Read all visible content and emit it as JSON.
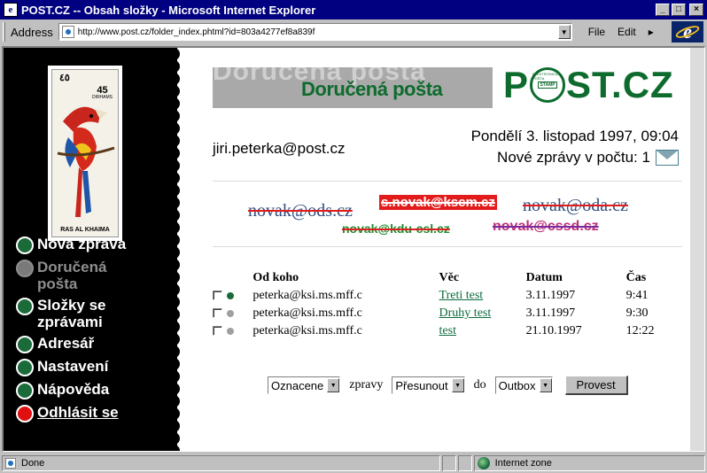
{
  "window": {
    "title": "POST.CZ -- Obsah složky - Microsoft Internet Explorer",
    "controls": {
      "minimize": "_",
      "maximize": "□",
      "close": "×"
    }
  },
  "address_bar": {
    "label": "Address",
    "url": "http://www.post.cz/folder_index.phtml?id=803a4277ef8a839f",
    "menu": [
      "File",
      "Edit"
    ]
  },
  "sidebar": {
    "stamp": {
      "denomination": "٤٥",
      "denomination_value": "45",
      "denomination_unit": "DIRHAMS",
      "country": "RAS AL KHAIMA"
    },
    "nav": [
      {
        "label": "Nová zpráva",
        "state": "active",
        "color": "#1b6b3a"
      },
      {
        "label": "Doručená pošta",
        "state": "inactive",
        "color": "#7a7a7a"
      },
      {
        "label": "Složky se zprávami",
        "state": "active",
        "color": "#1b6b3a"
      },
      {
        "label": "Adresář",
        "state": "active",
        "color": "#1b6b3a"
      },
      {
        "label": "Nastavení",
        "state": "active",
        "color": "#1b6b3a"
      },
      {
        "label": "Nápověda",
        "state": "active",
        "color": "#1b6b3a"
      },
      {
        "label": "Odhlásit se",
        "state": "logout",
        "color": "#e01010"
      }
    ]
  },
  "header": {
    "banner_title": "Doručená pošta",
    "banner_ghost": "Doručená pošta",
    "logo_p": "P",
    "logo_rest": "ST.CZ",
    "logo_stamp_word": "STAMP",
    "logo_arc_text": "ELEKTRONICKÁ POŠTA"
  },
  "user": {
    "email": "jiri.peterka@post.cz",
    "datetime": "Pondělí 3. listopad 1997, 09:04",
    "new_messages_label": "Nové zprávy v počtu:",
    "new_messages_count": "1"
  },
  "crossed_addresses": [
    "novak@ods.cz",
    "s.novak@kscm.cz",
    "novak@oda.cz",
    "novak@kdu-csl.cz",
    "novak@cssd.cz"
  ],
  "messages": {
    "headers": {
      "from": "Od koho",
      "subject": "Věc",
      "date": "Datum",
      "time": "Čas"
    },
    "rows": [
      {
        "from": "peterka@ksi.ms.mff.c",
        "subject": "Treti test",
        "date": "3.11.1997",
        "time": "9:41",
        "unread": true
      },
      {
        "from": "peterka@ksi.ms.mff.c",
        "subject": "Druhy test",
        "date": "3.11.1997",
        "time": "9:30",
        "unread": false
      },
      {
        "from": "peterka@ksi.ms.mff.c",
        "subject": "test",
        "date": "21.10.1997",
        "time": "12:22",
        "unread": false
      }
    ]
  },
  "actions": {
    "filter_select": "Oznacene",
    "word_messages": "zpravy",
    "action_select": "Přesunout",
    "word_to": "do",
    "folder_select": "Outbox",
    "submit_label": "Provest"
  },
  "status_bar": {
    "status": "Done",
    "zone": "Internet zone"
  },
  "colors": {
    "title_bar": "#000080",
    "brand_green": "#0d6b2d",
    "unread_dot": "#1b6b3a",
    "read_dot": "#a0a0a0",
    "logout_dot": "#e01010",
    "strike_red": "#e21b1b"
  }
}
